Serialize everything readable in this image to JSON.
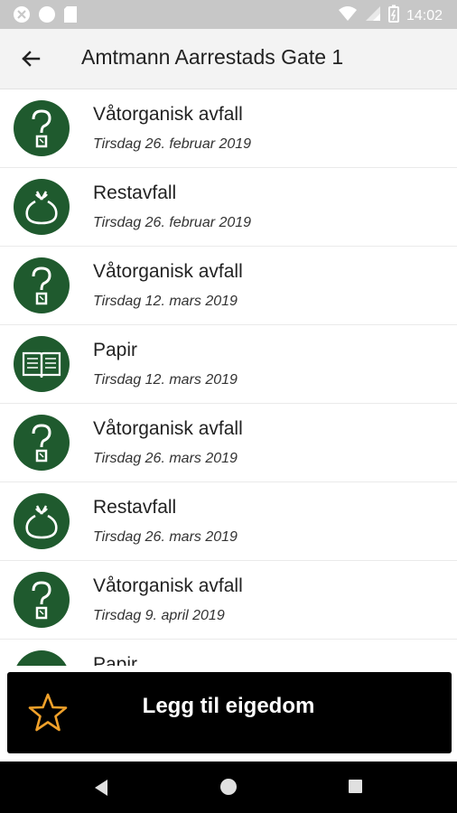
{
  "status_bar": {
    "time": "14:02"
  },
  "header": {
    "title": "Amtmann Aarrestads Gate 1"
  },
  "list": [
    {
      "title": "Våtorganisk avfall",
      "date": "Tirsdag 26. februar 2019",
      "icon": "question-icon"
    },
    {
      "title": "Restavfall",
      "date": "Tirsdag 26. februar 2019",
      "icon": "bag-icon"
    },
    {
      "title": "Våtorganisk avfall",
      "date": "Tirsdag 12. mars 2019",
      "icon": "question-icon"
    },
    {
      "title": "Papir",
      "date": "Tirsdag 12. mars 2019",
      "icon": "newspaper-icon"
    },
    {
      "title": "Våtorganisk avfall",
      "date": "Tirsdag 26. mars 2019",
      "icon": "question-icon"
    },
    {
      "title": "Restavfall",
      "date": "Tirsdag 26. mars 2019",
      "icon": "bag-icon"
    },
    {
      "title": "Våtorganisk avfall",
      "date": "Tirsdag 9. april 2019",
      "icon": "question-icon"
    },
    {
      "title": "Papir",
      "date": "",
      "icon": "newspaper-icon"
    }
  ],
  "action": {
    "label": "Legg til eigedom",
    "icon": "star-icon"
  },
  "colors": {
    "icon_bg": "#1f5a2e",
    "star": "#f0a12a",
    "action_bg": "#000000"
  }
}
